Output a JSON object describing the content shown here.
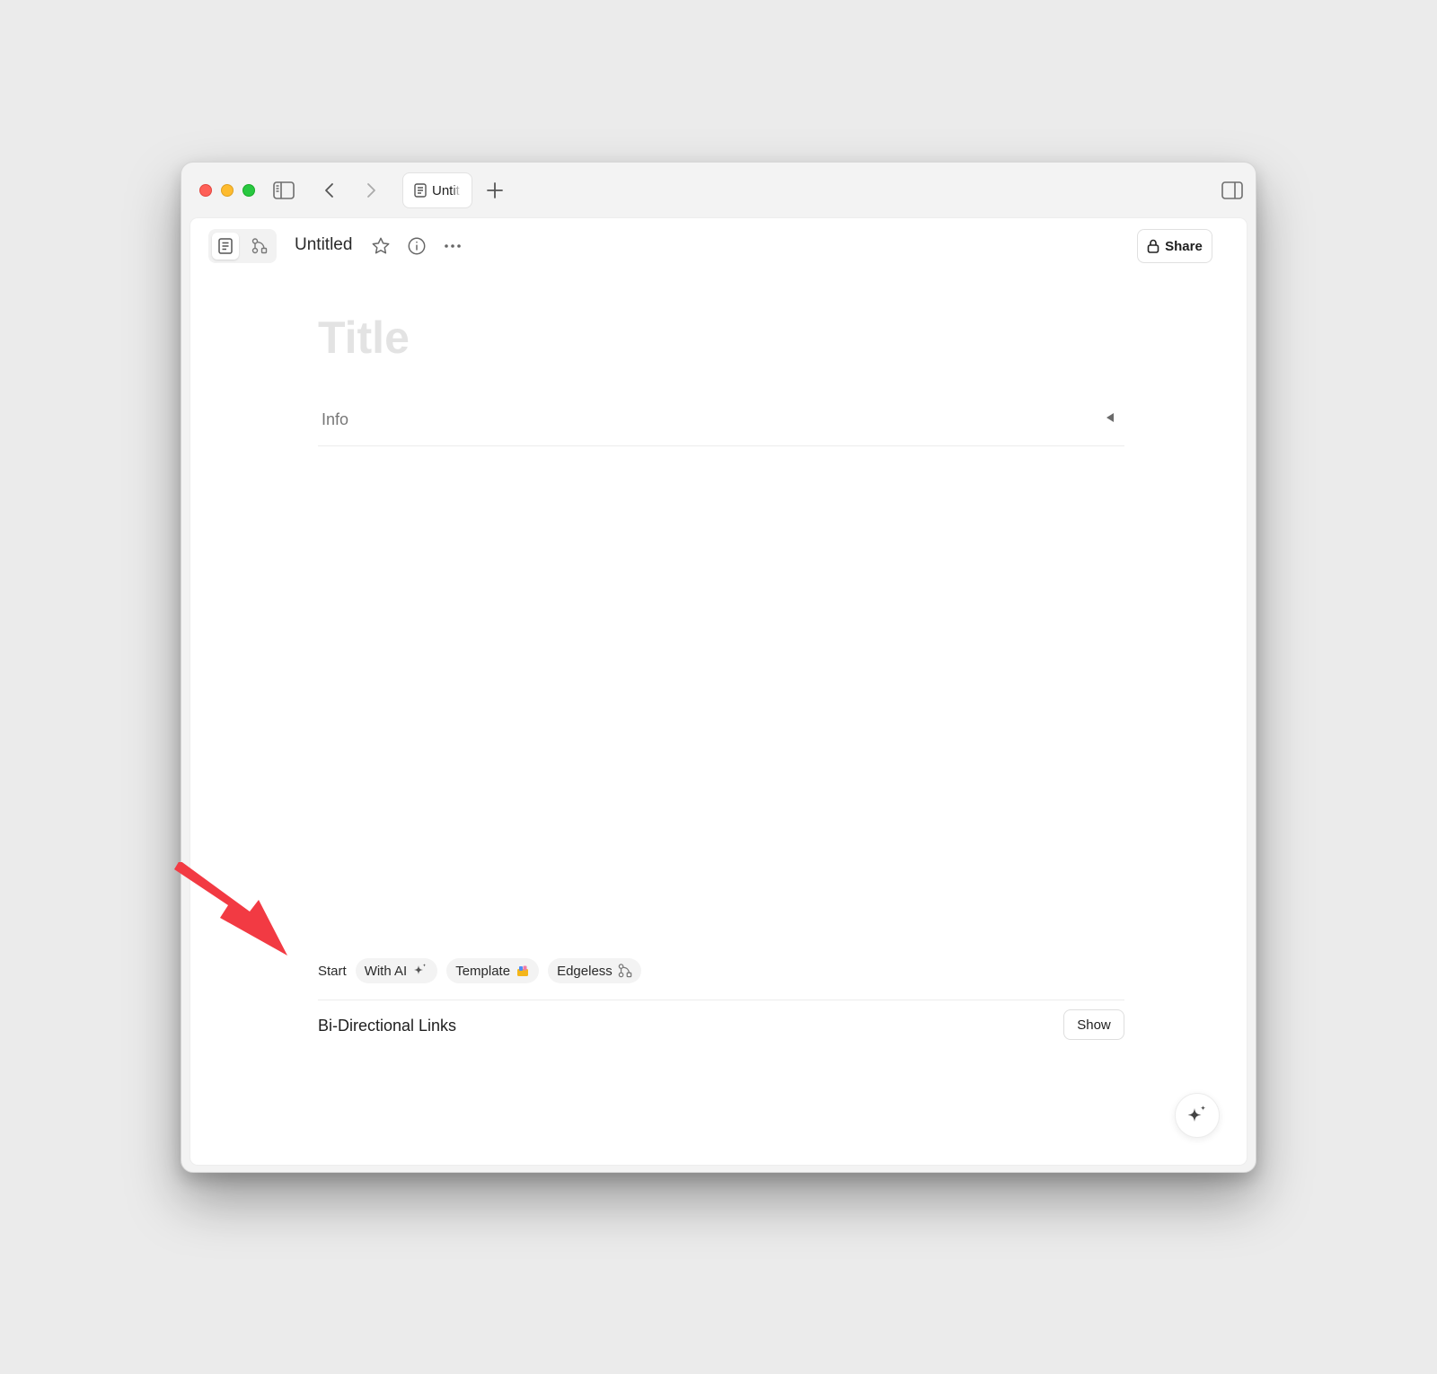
{
  "tabs": [
    {
      "label": "Untit",
      "icon": "page-icon"
    }
  ],
  "header": {
    "doc_name": "Untitled",
    "share_label": "Share"
  },
  "editor": {
    "title_placeholder": "Title",
    "info_label": "Info"
  },
  "start_options": {
    "start_label": "Start",
    "with_ai_label": "With AI",
    "template_label": "Template",
    "edgeless_label": "Edgeless"
  },
  "bidirectional": {
    "label": "Bi-Directional Links",
    "show_label": "Show"
  },
  "colors": {
    "close": "#fe5f57",
    "minimize": "#febb2e",
    "maximize": "#28c840",
    "annotation_arrow": "#f23a43",
    "title_placeholder": "#e3e3e3"
  }
}
